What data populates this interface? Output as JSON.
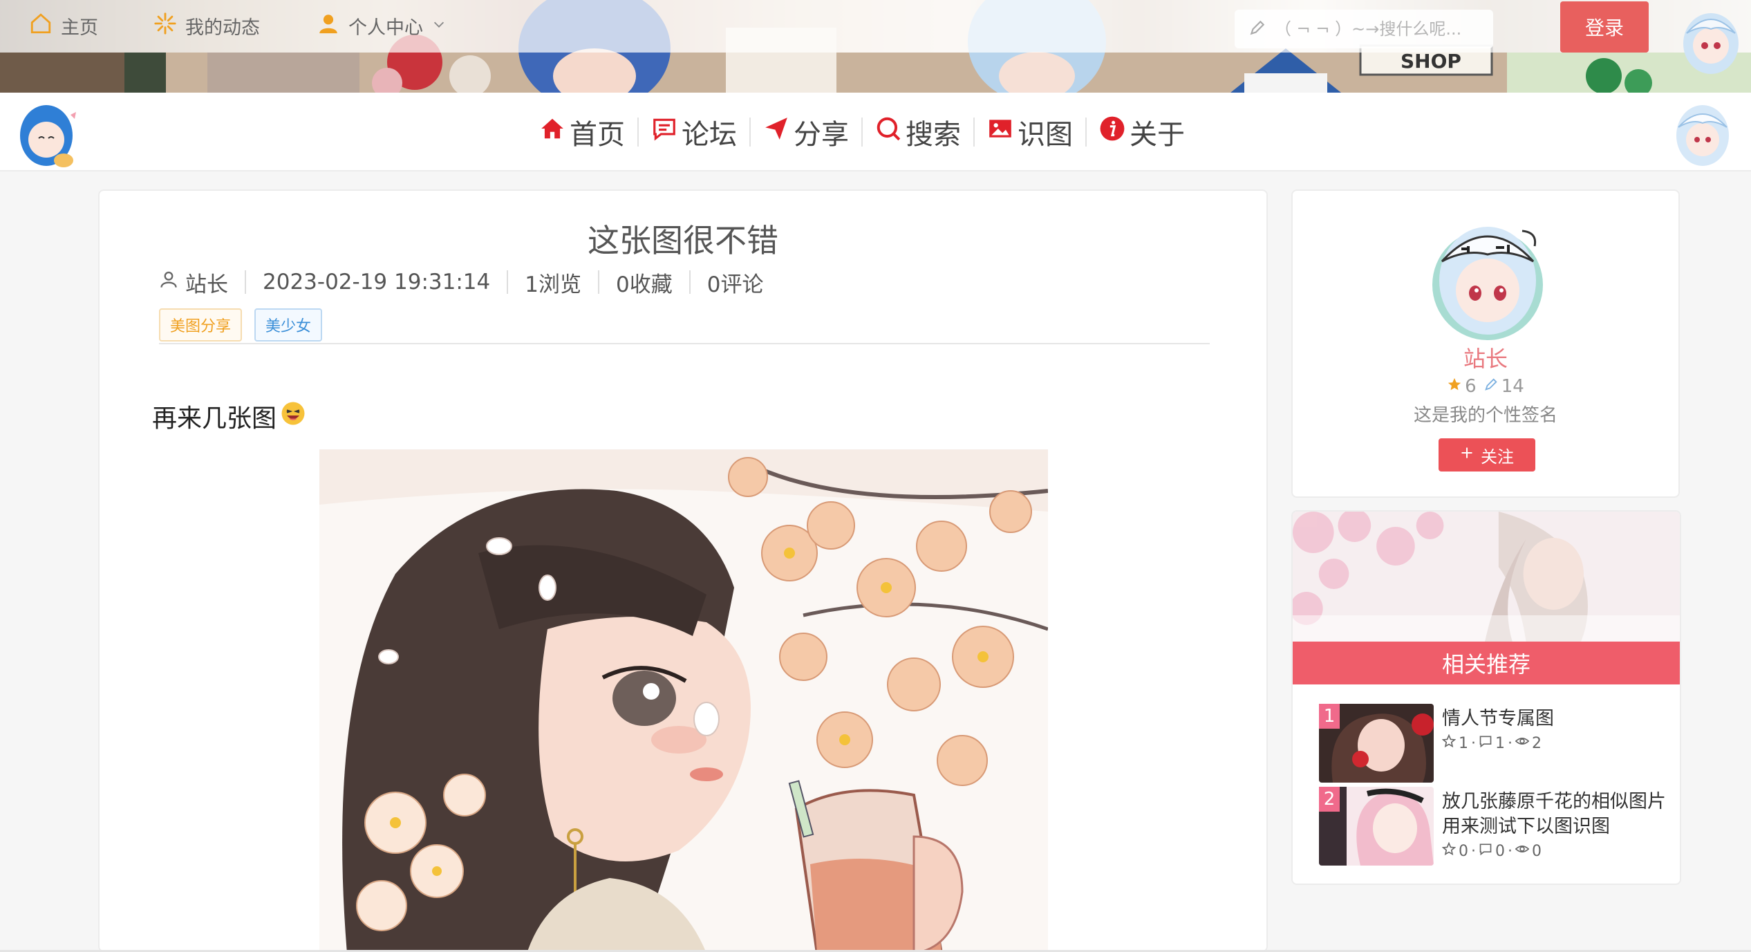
{
  "topnav": {
    "items": [
      {
        "label": "主页"
      },
      {
        "label": "我的动态"
      },
      {
        "label": "个人中心"
      }
    ],
    "search_placeholder": "（ ¬ ¬ ）~→搜什么呢...",
    "login_label": "登录",
    "banner_sign": "SHOP"
  },
  "mainnav": {
    "items": [
      {
        "label": "首页"
      },
      {
        "label": "论坛"
      },
      {
        "label": "分享"
      },
      {
        "label": "搜索"
      },
      {
        "label": "识图"
      },
      {
        "label": "关于"
      }
    ]
  },
  "article": {
    "title": "这张图很不错",
    "author": "站长",
    "datetime": "2023-02-19 19:31:14",
    "views": "1浏览",
    "favorites": "0收藏",
    "comments": "0评论",
    "tags": [
      "美图分享",
      "美少女"
    ],
    "body_text": "再来几张图"
  },
  "author_card": {
    "name": "站长",
    "stars": "6",
    "posts": "14",
    "signature": "这是我的个性签名",
    "follow_label": "关注"
  },
  "recommend": {
    "title": "相关推荐",
    "items": [
      {
        "rank": "1",
        "name": "情人节专属图",
        "favorites": "1",
        "comments": "1",
        "views": "2"
      },
      {
        "rank": "2",
        "name": "放几张藤原千花的相似图片用来测试下以图识图",
        "favorites": "0",
        "comments": "0",
        "views": "0"
      }
    ]
  },
  "colors": {
    "accent_red": "#ec5157",
    "nav_icon_red": "#e0212a",
    "author_pink": "#e9797f",
    "tag_orange": "#f0a020",
    "tag_blue": "#3b8fd8"
  }
}
